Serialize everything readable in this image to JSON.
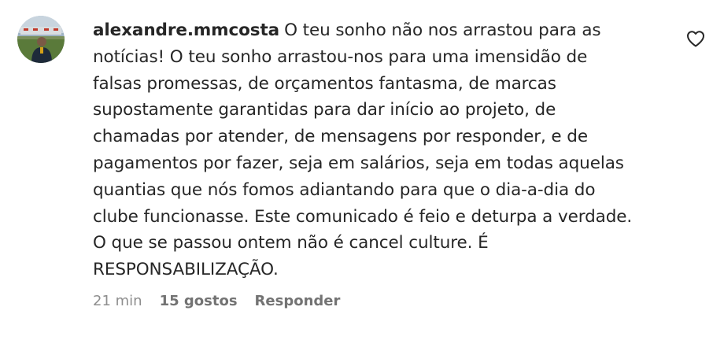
{
  "comment": {
    "username": "alexandre.mmcosta",
    "lines": [
      "O teu sonho não nos arrastou para as",
      "notícias! O teu sonho arrastou-nos para uma imensidão de",
      "falsas promessas, de orçamentos fantasma, de marcas",
      "supostamente garantidas para dar início ao projeto, de",
      "chamadas por atender, de mensagens por responder, e de",
      "pagamentos por fazer, seja em salários, seja em todas aquelas",
      "quantias que nós fomos adiantando para que o dia-a-dia do",
      "clube funcionasse. Este comunicado é feio e deturpa a verdade.",
      "O que se passou ontem não é cancel culture. É",
      "RESPONSABILIZAÇÃO."
    ],
    "time": "21 min",
    "likes": "15 gostos",
    "reply_label": "Responder",
    "like_icon": "heart-icon"
  }
}
